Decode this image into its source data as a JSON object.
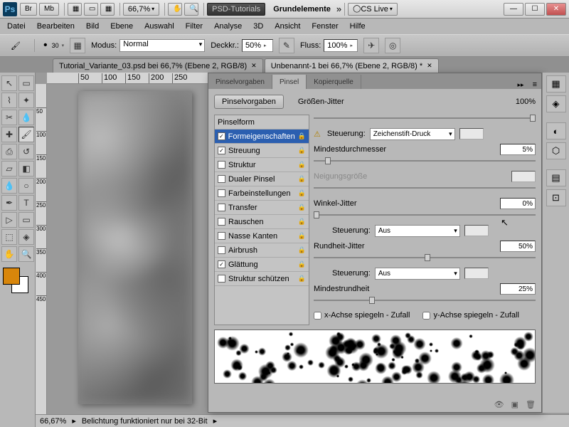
{
  "title": {
    "ps": "Ps",
    "br": "Br",
    "mb": "Mb",
    "zoom": "66,7%",
    "app": "PSD-Tutorials",
    "doc": "Grundelemente",
    "cslive": "CS Live"
  },
  "menu": [
    "Datei",
    "Bearbeiten",
    "Bild",
    "Ebene",
    "Auswahl",
    "Filter",
    "Analyse",
    "3D",
    "Ansicht",
    "Fenster",
    "Hilfe"
  ],
  "optbar": {
    "size": "30",
    "modus_lbl": "Modus:",
    "modus": "Normal",
    "deck_lbl": "Deckkr.:",
    "deck": "50%",
    "fluss_lbl": "Fluss:",
    "fluss": "100%"
  },
  "tabs": [
    {
      "label": "Tutorial_Variante_03.psd bei 66,7% (Ebene 2, RGB/8)",
      "active": false
    },
    {
      "label": "Unbenannt-1 bei 66,7% (Ebene 2, RGB/8) *",
      "active": true
    }
  ],
  "status": {
    "zoom": "66,67%",
    "msg": "Belichtung funktioniert nur bei 32-Bit"
  },
  "panel": {
    "tabs": [
      "Pinselvorgaben",
      "Pinsel",
      "Kopierquelle"
    ],
    "vorgaben_btn": "Pinselvorgaben",
    "list": [
      {
        "chk": null,
        "label": "Pinselform",
        "lock": false
      },
      {
        "chk": true,
        "label": "Formeigenschaften",
        "lock": true,
        "sel": true
      },
      {
        "chk": true,
        "label": "Streuung",
        "lock": true
      },
      {
        "chk": false,
        "label": "Struktur",
        "lock": true
      },
      {
        "chk": false,
        "label": "Dualer Pinsel",
        "lock": true
      },
      {
        "chk": false,
        "label": "Farbeinstellungen",
        "lock": true
      },
      {
        "chk": false,
        "label": "Transfer",
        "lock": true
      },
      {
        "chk": false,
        "label": "Rauschen",
        "lock": true
      },
      {
        "chk": false,
        "label": "Nasse Kanten",
        "lock": true
      },
      {
        "chk": false,
        "label": "Airbrush",
        "lock": true
      },
      {
        "chk": true,
        "label": "Glättung",
        "lock": true
      },
      {
        "chk": false,
        "label": "Struktur schützen",
        "lock": true
      }
    ],
    "ctrl": {
      "groessen_jitter": "Größen-Jitter",
      "groessen_jitter_v": "100%",
      "steuerung": "Steuerung:",
      "steuerung1": "Zeichenstift-Druck",
      "mindest_d": "Mindestdurchmesser",
      "mindest_d_v": "5%",
      "neigung": "Neigungsgröße",
      "winkel": "Winkel-Jitter",
      "winkel_v": "0%",
      "steuerung2": "Aus",
      "rundheit": "Rundheit-Jitter",
      "rundheit_v": "50%",
      "steuerung3": "Aus",
      "mindest_r": "Mindestrundheit",
      "mindest_r_v": "25%",
      "xmirror": "x-Achse spiegeln - Zufall",
      "ymirror": "y-Achse spiegeln - Zufall"
    }
  },
  "rulerH": [
    "50",
    "100",
    "150",
    "200",
    "250"
  ],
  "rulerV": [
    "50",
    "100",
    "150",
    "200",
    "250",
    "300",
    "350",
    "400",
    "450"
  ]
}
